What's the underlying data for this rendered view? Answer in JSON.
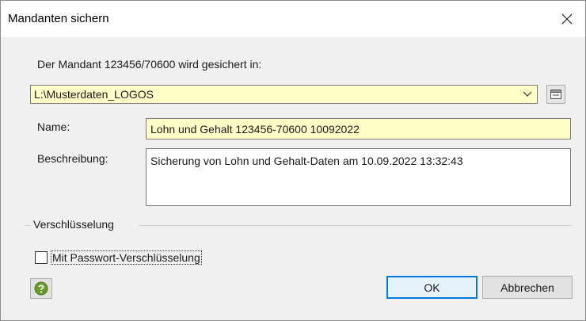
{
  "window": {
    "title": "Mandanten sichern"
  },
  "intro_text": "Der Mandant 123456/70600 wird gesichert in:",
  "path": {
    "value": "L:\\Musterdaten_LOGOS"
  },
  "name": {
    "label": "Name:",
    "value": "Lohn und Gehalt 123456-70600 10092022"
  },
  "description": {
    "label": "Beschreibung:",
    "value": "Sicherung von Lohn und Gehalt-Daten am 10.09.2022 13:32:43"
  },
  "encryption": {
    "group_label": "Verschlüsselung",
    "checkbox_label": "Mit Passwort-Verschlüsselung",
    "checked": false
  },
  "buttons": {
    "ok": "OK",
    "cancel": "Abbrechen"
  },
  "icons": {
    "close": "close-icon",
    "dropdown": "chevron-down-icon",
    "browse": "folder-browse-icon",
    "help": "help-icon"
  },
  "colors": {
    "highlight_field": "#ffffc8",
    "accent": "#0078d7",
    "help_green": "#6a9a2a"
  }
}
